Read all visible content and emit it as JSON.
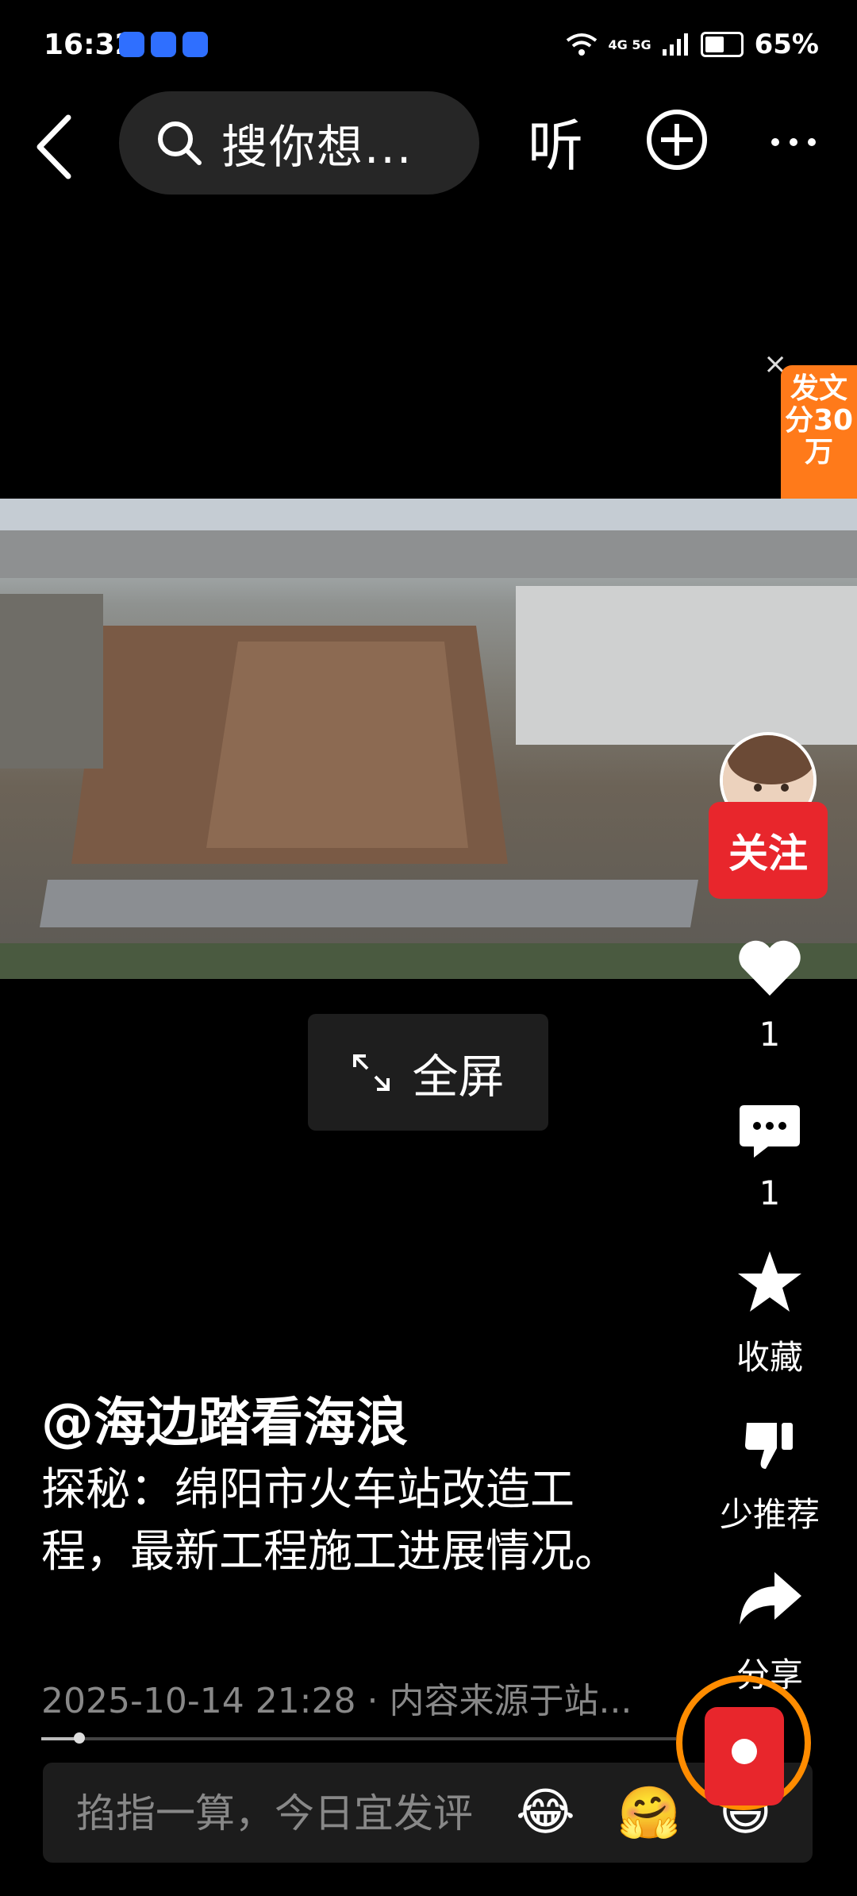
{
  "status": {
    "time": "16:32",
    "network": "4G 5G",
    "battery_pct": "65%",
    "battery_level": 0.65
  },
  "nav": {
    "search_placeholder": "搜你想...",
    "listen_label": "听"
  },
  "promo": {
    "close": "×",
    "text": "发文分30万"
  },
  "player": {
    "fullscreen_label": "全屏",
    "progress": 0.06
  },
  "rail": {
    "follow_label": "关注",
    "like_count": "1",
    "comment_count": "1",
    "favorite_label": "收藏",
    "less_recommend_label": "少推荐",
    "share_label": "分享"
  },
  "post": {
    "author": "@海边踏看海浪",
    "description": "探秘：绵阳市火车站改造工程，最新工程施工进展情况。",
    "meta": "2025-10-14 21:28 · 内容来源于站..."
  },
  "comment": {
    "placeholder": "掐指一算，今日宜发评",
    "emojis": [
      "😂",
      "🤗",
      "😄"
    ]
  },
  "colors": {
    "accent_red": "#e8262c",
    "promo_orange": "#ff7a1a",
    "ring_orange": "#ff8c00"
  }
}
